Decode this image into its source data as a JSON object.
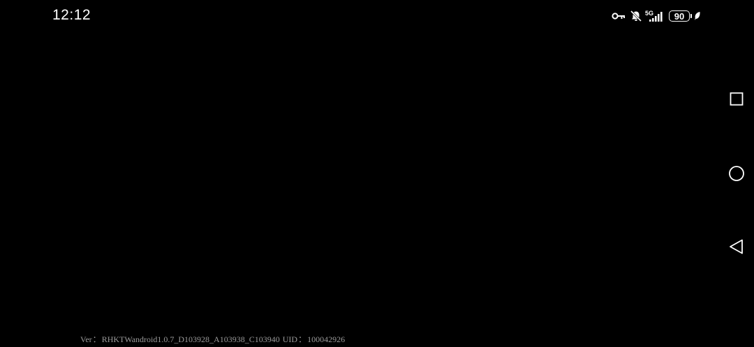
{
  "status_bar": {
    "time": "12:12",
    "network_label": "5G",
    "battery_level": "90",
    "icons": [
      "key-icon",
      "bell-off-icon",
      "5g-signal-icon",
      "battery-icon",
      "leaf-icon"
    ]
  },
  "nav_bar": {
    "icons": [
      "recents-square-icon",
      "home-circle-icon",
      "back-triangle-icon"
    ]
  },
  "footer": {
    "version_label": "Ver",
    "version_separator": "：",
    "version_value": "RHKTWandroid1.0.7_D103928_A103938_C103940",
    "uid_label": "UID",
    "uid_separator": "：",
    "uid_value": "100042926"
  },
  "colors": {
    "background": "#000000",
    "foreground": "#ffffff",
    "footer_text": "#9a9a9a"
  }
}
